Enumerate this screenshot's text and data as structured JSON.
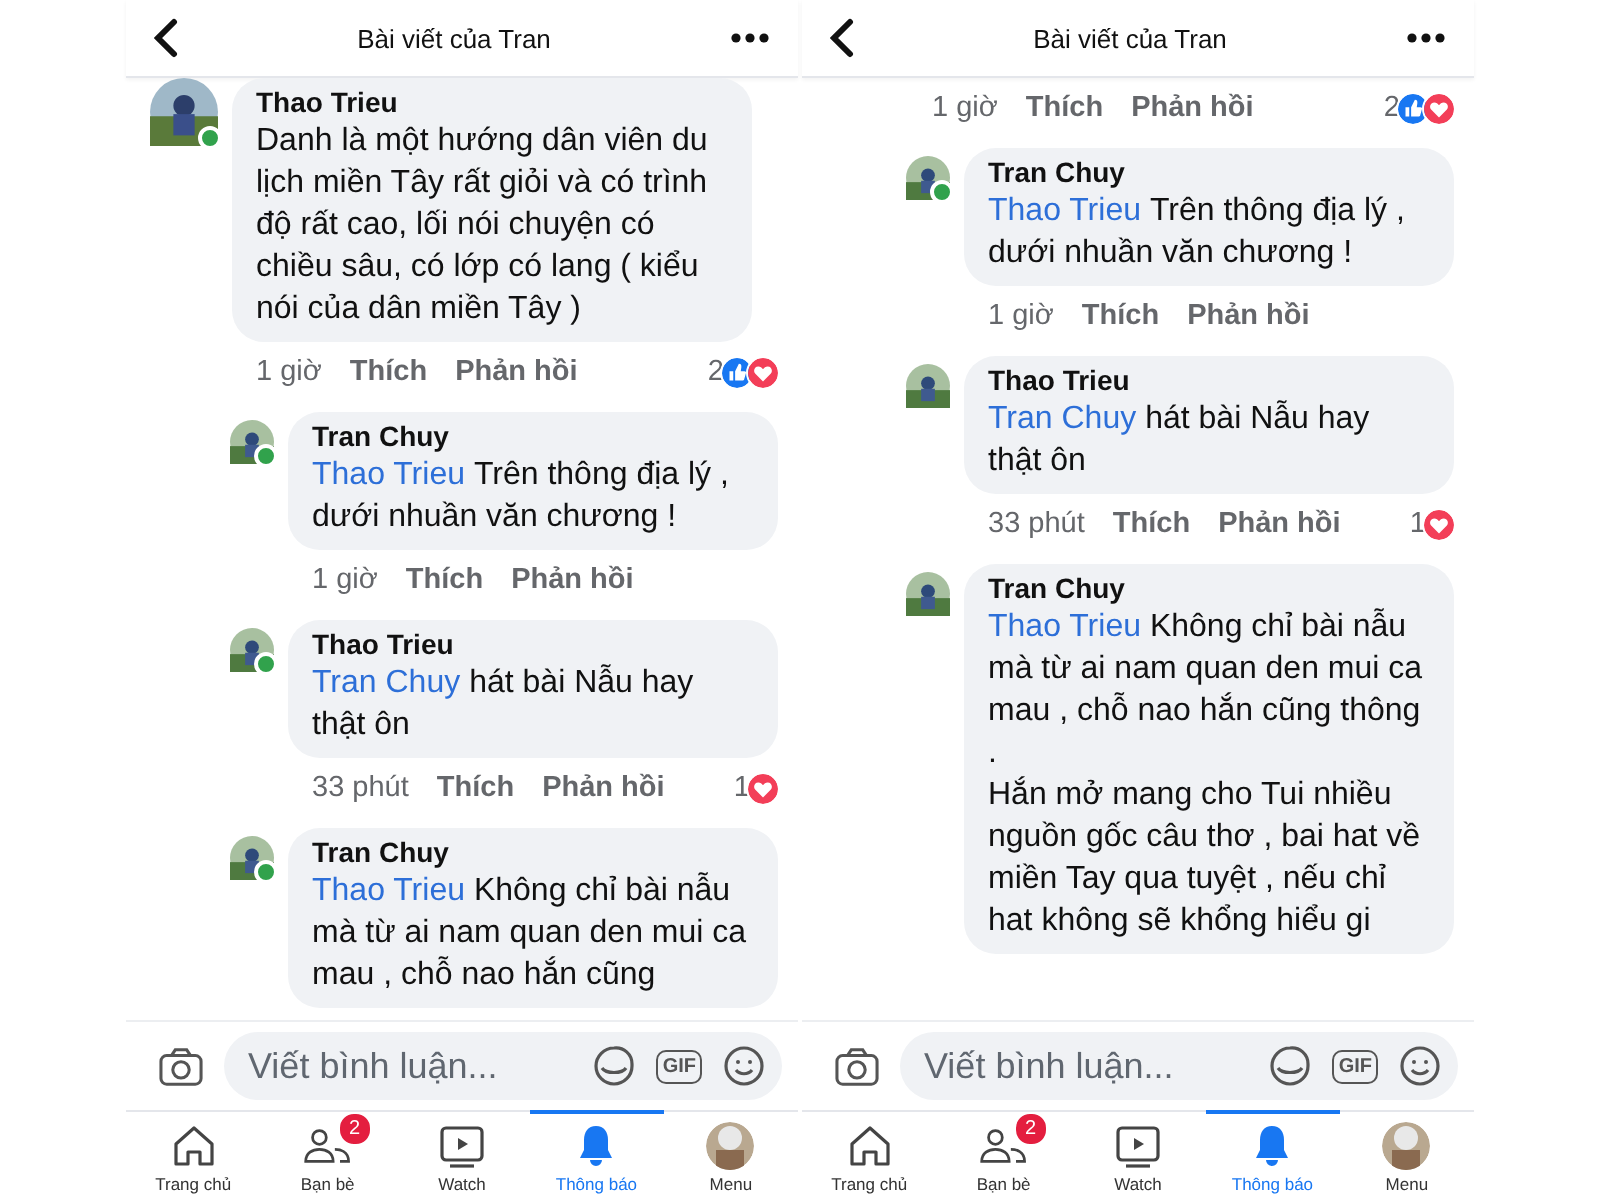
{
  "phones": [
    {
      "header": {
        "title": "Bài viết của Tran"
      },
      "comments": [
        {
          "name": "Thao Trieu",
          "online": true,
          "text": "Danh là một hướng dân viên du lịch miền Tây rất giỏi và có trình độ rất cao, lối nói chuyện có chiều sâu, có lớp có lang ( kiểu nói của dân miền Tây )",
          "time": "1 giờ",
          "like": "Thích",
          "reply": "Phản hồi",
          "reaction_count": "2",
          "like_reaction": true,
          "love_reaction": true,
          "children": [
            {
              "name": "Tran Chuy",
              "online": true,
              "mention": "Thao Trieu",
              "text": "Trên thông địa lý , dưới nhuần văn chương !",
              "time": "1 giờ",
              "like": "Thích",
              "reply": "Phản hồi"
            },
            {
              "name": "Thao Trieu",
              "online": true,
              "mention": "Tran Chuy",
              "text": "hát bài Nẫu hay thật ôn",
              "time": "33 phút",
              "like": "Thích",
              "reply": "Phản hồi",
              "reaction_count": "1",
              "love_reaction": true
            },
            {
              "name": "Tran Chuy",
              "online": true,
              "mention": "Thao Trieu",
              "text": "Không chỉ bài nẫu mà từ ai nam quan den mui ca mau , chỗ nao hắn cũng"
            }
          ]
        }
      ],
      "composer": {
        "placeholder": "Viết bình luận...",
        "gif_label": "GIF"
      },
      "tabs": [
        {
          "kind": "home",
          "label": "Trang chủ",
          "selected": false
        },
        {
          "kind": "friends",
          "label": "Bạn bè",
          "badge": "2",
          "selected": false
        },
        {
          "kind": "watch",
          "label": "Watch",
          "selected": false
        },
        {
          "kind": "bell",
          "label": "Thông báo",
          "selected": true
        },
        {
          "kind": "avatar",
          "label": "Menu",
          "selected": false
        }
      ]
    },
    {
      "header": {
        "title": "Bài viết của Tran"
      },
      "comments": [
        {
          "time": "1 giờ",
          "like": "Thích",
          "reply": "Phản hồi",
          "reaction_count": "2",
          "like_reaction": true,
          "love_reaction": true,
          "children": [
            {
              "name": "Tran Chuy",
              "online": true,
              "mention": "Thao Trieu",
              "text": "Trên thông địa lý , dưới nhuần văn chương !",
              "time": "1 giờ",
              "like": "Thích",
              "reply": "Phản hồi"
            },
            {
              "name": "Thao Trieu",
              "mention": "Tran Chuy",
              "text": "hát bài Nẫu hay thật ôn",
              "time": "33 phút",
              "like": "Thích",
              "reply": "Phản hồi",
              "reaction_count": "1",
              "love_reaction": true
            },
            {
              "name": "Tran Chuy",
              "mention": "Thao Trieu",
              "text": "Không chỉ bài nẫu mà từ ai nam quan den mui ca mau , chỗ nao hắn cũng thông .\nHắn mở mang cho Tui nhiều nguồn gốc câu thơ , bai hat về miền Tay qua tuyệt , nếu chỉ hat không sẽ khổng hiểu gi"
            }
          ]
        }
      ],
      "composer": {
        "placeholder": "Viết bình luận...",
        "gif_label": "GIF"
      },
      "tabs": [
        {
          "kind": "home",
          "label": "Trang chủ",
          "selected": false
        },
        {
          "kind": "friends",
          "label": "Bạn bè",
          "badge": "2",
          "selected": false
        },
        {
          "kind": "watch",
          "label": "Watch",
          "selected": false
        },
        {
          "kind": "bell",
          "label": "Thông báo",
          "selected": true
        },
        {
          "kind": "avatar",
          "label": "Menu",
          "selected": false
        }
      ]
    }
  ]
}
